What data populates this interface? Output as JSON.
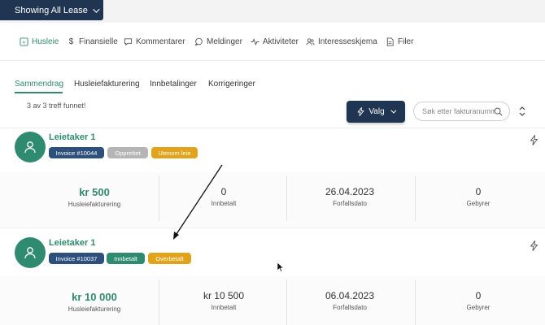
{
  "header": {
    "lease_selector_label": "Showing All Lease"
  },
  "nav": {
    "items": [
      {
        "label": "Husleie",
        "icon": "document-icon",
        "active": true
      },
      {
        "label": "Finansielle",
        "icon": "dollar-icon"
      },
      {
        "label": "Kommentarer",
        "icon": "comment-icon"
      },
      {
        "label": "Meldinger",
        "icon": "message-icon"
      },
      {
        "label": "Aktiviteter",
        "icon": "activity-icon"
      },
      {
        "label": "Interesseskjema",
        "icon": "users-icon"
      },
      {
        "label": "Filer",
        "icon": "file-icon"
      }
    ]
  },
  "subtabs": [
    {
      "label": "Sammendrag",
      "active": true
    },
    {
      "label": "Husleiefakturering"
    },
    {
      "label": "Innbetalinger"
    },
    {
      "label": "Korrigeringer"
    }
  ],
  "results": {
    "count_text": "3 av 3 treff funnet!"
  },
  "toolbar": {
    "valg_label": "Valg",
    "search_placeholder": "Søk etter fakturanummer"
  },
  "colors": {
    "accent": "#2e8b6f",
    "navy": "#1f3551",
    "invoice": "#2d4f7c",
    "orange": "#e1a319",
    "gray": "#b5b5b5"
  },
  "leases": [
    {
      "tenant": "Leietaker 1",
      "invoice": "Invoice #10044",
      "status": "Opprettet",
      "tag": "Utenom leie",
      "stats": [
        {
          "value": "kr 500",
          "label": "Husleiefakturering"
        },
        {
          "value": "0",
          "label": "Innbetalt"
        },
        {
          "value": "26.04.2023",
          "label": "Forfallsdato"
        },
        {
          "value": "0",
          "label": "Gebyrer"
        }
      ]
    },
    {
      "tenant": "Leietaker 1",
      "invoice": "Invoice #10037",
      "status": "Innbetalt",
      "tag": "Overbetalt",
      "stats": [
        {
          "value": "kr 10 000",
          "label": "Husleiefakturering"
        },
        {
          "value": "kr 10 500",
          "label": "Innbetalt"
        },
        {
          "value": "06.04.2023",
          "label": "Forfallsdato"
        },
        {
          "value": "0",
          "label": "Gebyrer"
        }
      ]
    }
  ]
}
